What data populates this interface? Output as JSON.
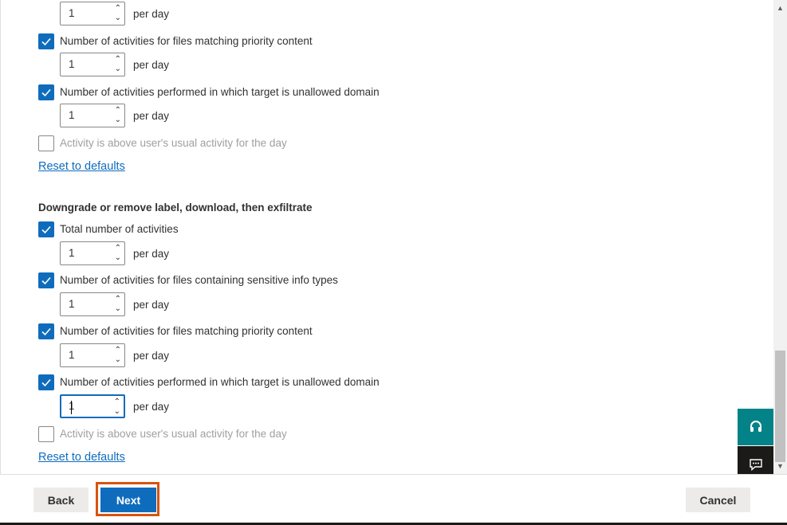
{
  "top_section": {
    "total_activities": {
      "value": "1",
      "suffix": "per day"
    },
    "priority_content": {
      "label": "Number of activities for files matching priority content",
      "checked": true,
      "value": "1",
      "suffix": "per day"
    },
    "unallowed_domain": {
      "label": "Number of activities performed in which target is unallowed domain",
      "checked": true,
      "value": "1",
      "suffix": "per day"
    },
    "above_usual": {
      "label": "Activity is above user's usual activity for the day",
      "checked": false
    },
    "reset_label": "Reset to defaults"
  },
  "downgrade_section": {
    "title": "Downgrade or remove label, download, then exfiltrate",
    "total": {
      "label": "Total number of activities",
      "checked": true,
      "value": "1",
      "suffix": "per day"
    },
    "sensitive": {
      "label": "Number of activities for files containing sensitive info types",
      "checked": true,
      "value": "1",
      "suffix": "per day"
    },
    "priority_content": {
      "label": "Number of activities for files matching priority content",
      "checked": true,
      "value": "1",
      "suffix": "per day"
    },
    "unallowed_domain": {
      "label": "Number of activities performed in which target is unallowed domain",
      "checked": true,
      "value": "1",
      "suffix": "per day"
    },
    "above_usual": {
      "label": "Activity is above user's usual activity for the day",
      "checked": false
    },
    "reset_label": "Reset to defaults"
  },
  "footer": {
    "back_label": "Back",
    "next_label": "Next",
    "cancel_label": "Cancel"
  },
  "floating": {
    "help_icon": "headset-icon",
    "chat_icon": "feedback-icon"
  },
  "colors": {
    "accent": "#0f6cbd",
    "highlight": "#d9530f",
    "help_bg": "#038387",
    "chat_bg": "#1b1a19"
  }
}
